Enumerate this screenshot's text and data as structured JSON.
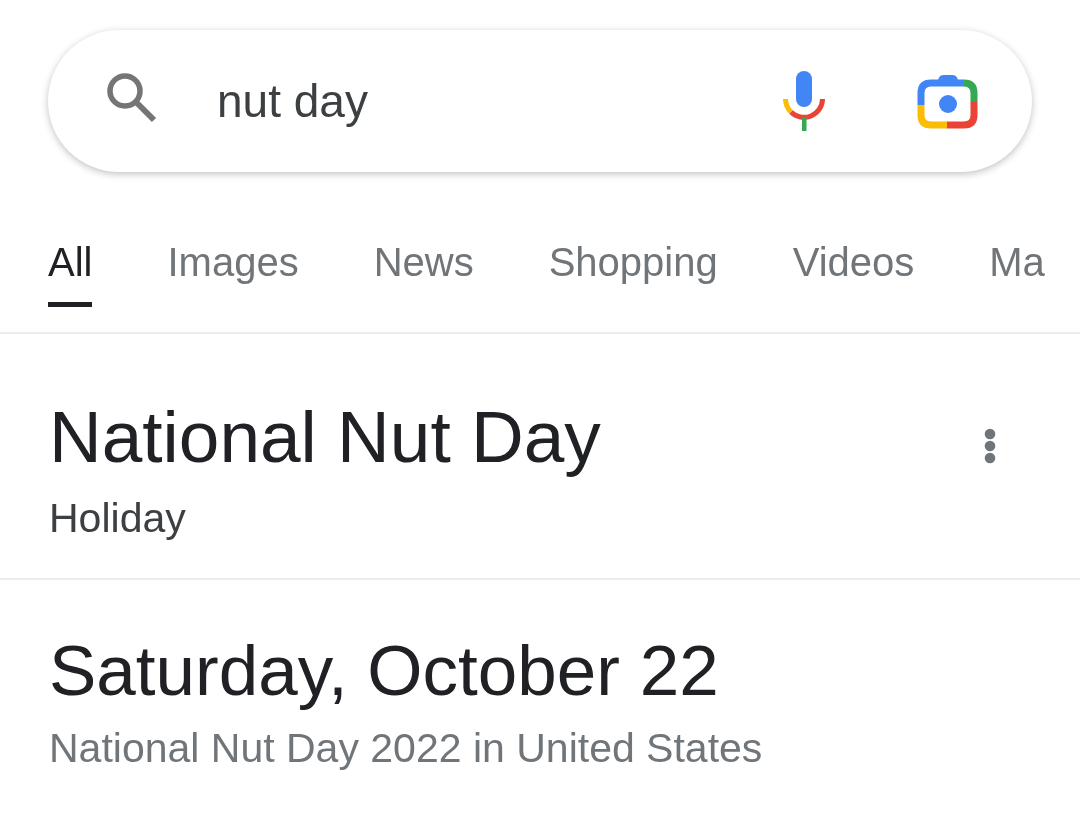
{
  "search": {
    "value": "nut day"
  },
  "tabs": [
    {
      "label": "All",
      "selected": true
    },
    {
      "label": "Images",
      "selected": false
    },
    {
      "label": "News",
      "selected": false
    },
    {
      "label": "Shopping",
      "selected": false
    },
    {
      "label": "Videos",
      "selected": false
    },
    {
      "label": "Ma",
      "selected": false
    }
  ],
  "knowledge_panel": {
    "title": "National Nut Day",
    "subtitle": "Holiday"
  },
  "date_answer": {
    "date": "Saturday, October 22",
    "caption": "National Nut Day 2022 in United States"
  }
}
